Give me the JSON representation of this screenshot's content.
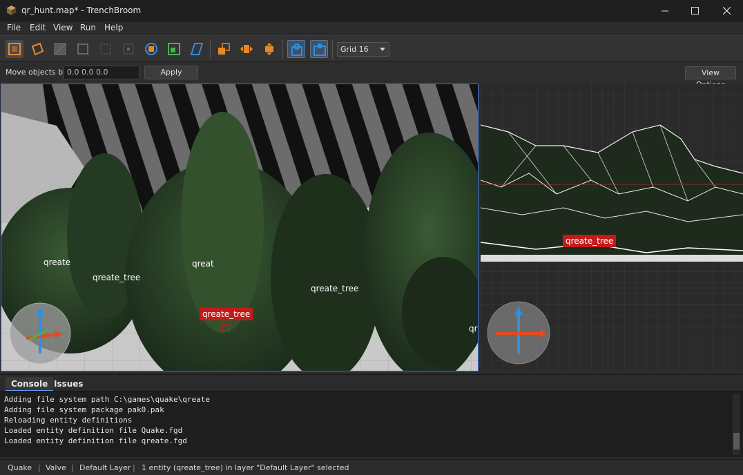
{
  "window": {
    "title": "qr_hunt.map* - TrenchBroom"
  },
  "menu": {
    "file": "File",
    "edit": "Edit",
    "view": "View",
    "run": "Run",
    "help": "Help"
  },
  "toolbar": {
    "grid_value": "Grid 16",
    "tools": [
      "select-tool-icon",
      "brush-tool-icon",
      "face-tool-icon",
      "vertex-tool-icon",
      "edge-tool-icon",
      "point-tool-icon",
      "rotate-tool-icon",
      "scale-tool-icon",
      "shear-tool-icon",
      "duplicate-icon",
      "flip-horizontal-icon",
      "flip-vertical-icon",
      "texture-lock-icon",
      "uv-lock-icon"
    ]
  },
  "move_bar": {
    "label": "Move objects by",
    "value": "0.0 0.0 0.0",
    "apply": "Apply",
    "view_options": "View Options"
  },
  "viewport3d": {
    "labels": [
      "qreate",
      "qreate_tree",
      "qreat",
      "qreate_tree",
      "qr"
    ],
    "selected_label": "qreate_tree"
  },
  "viewport2d": {
    "selected_label": "qreate_tree"
  },
  "console": {
    "tabs": [
      "Console",
      "Issues"
    ],
    "lines": [
      "Adding file system path C:\\games\\quake\\qreate",
      "Adding file system package pak0.pak",
      "Reloading entity definitions",
      "Loaded entity definition file Quake.fgd",
      "Loaded entity definition file qreate.fgd"
    ]
  },
  "status": {
    "game": "Quake",
    "format": "Valve",
    "layer": "Default Layer",
    "selection": "1 entity (qreate_tree) in layer \"Default Layer\" selected"
  },
  "colors": {
    "accent": "#3d78d8",
    "selection": "#c41a1a",
    "tool_orange": "#e8882a",
    "tool_blue": "#2f8fe0"
  }
}
